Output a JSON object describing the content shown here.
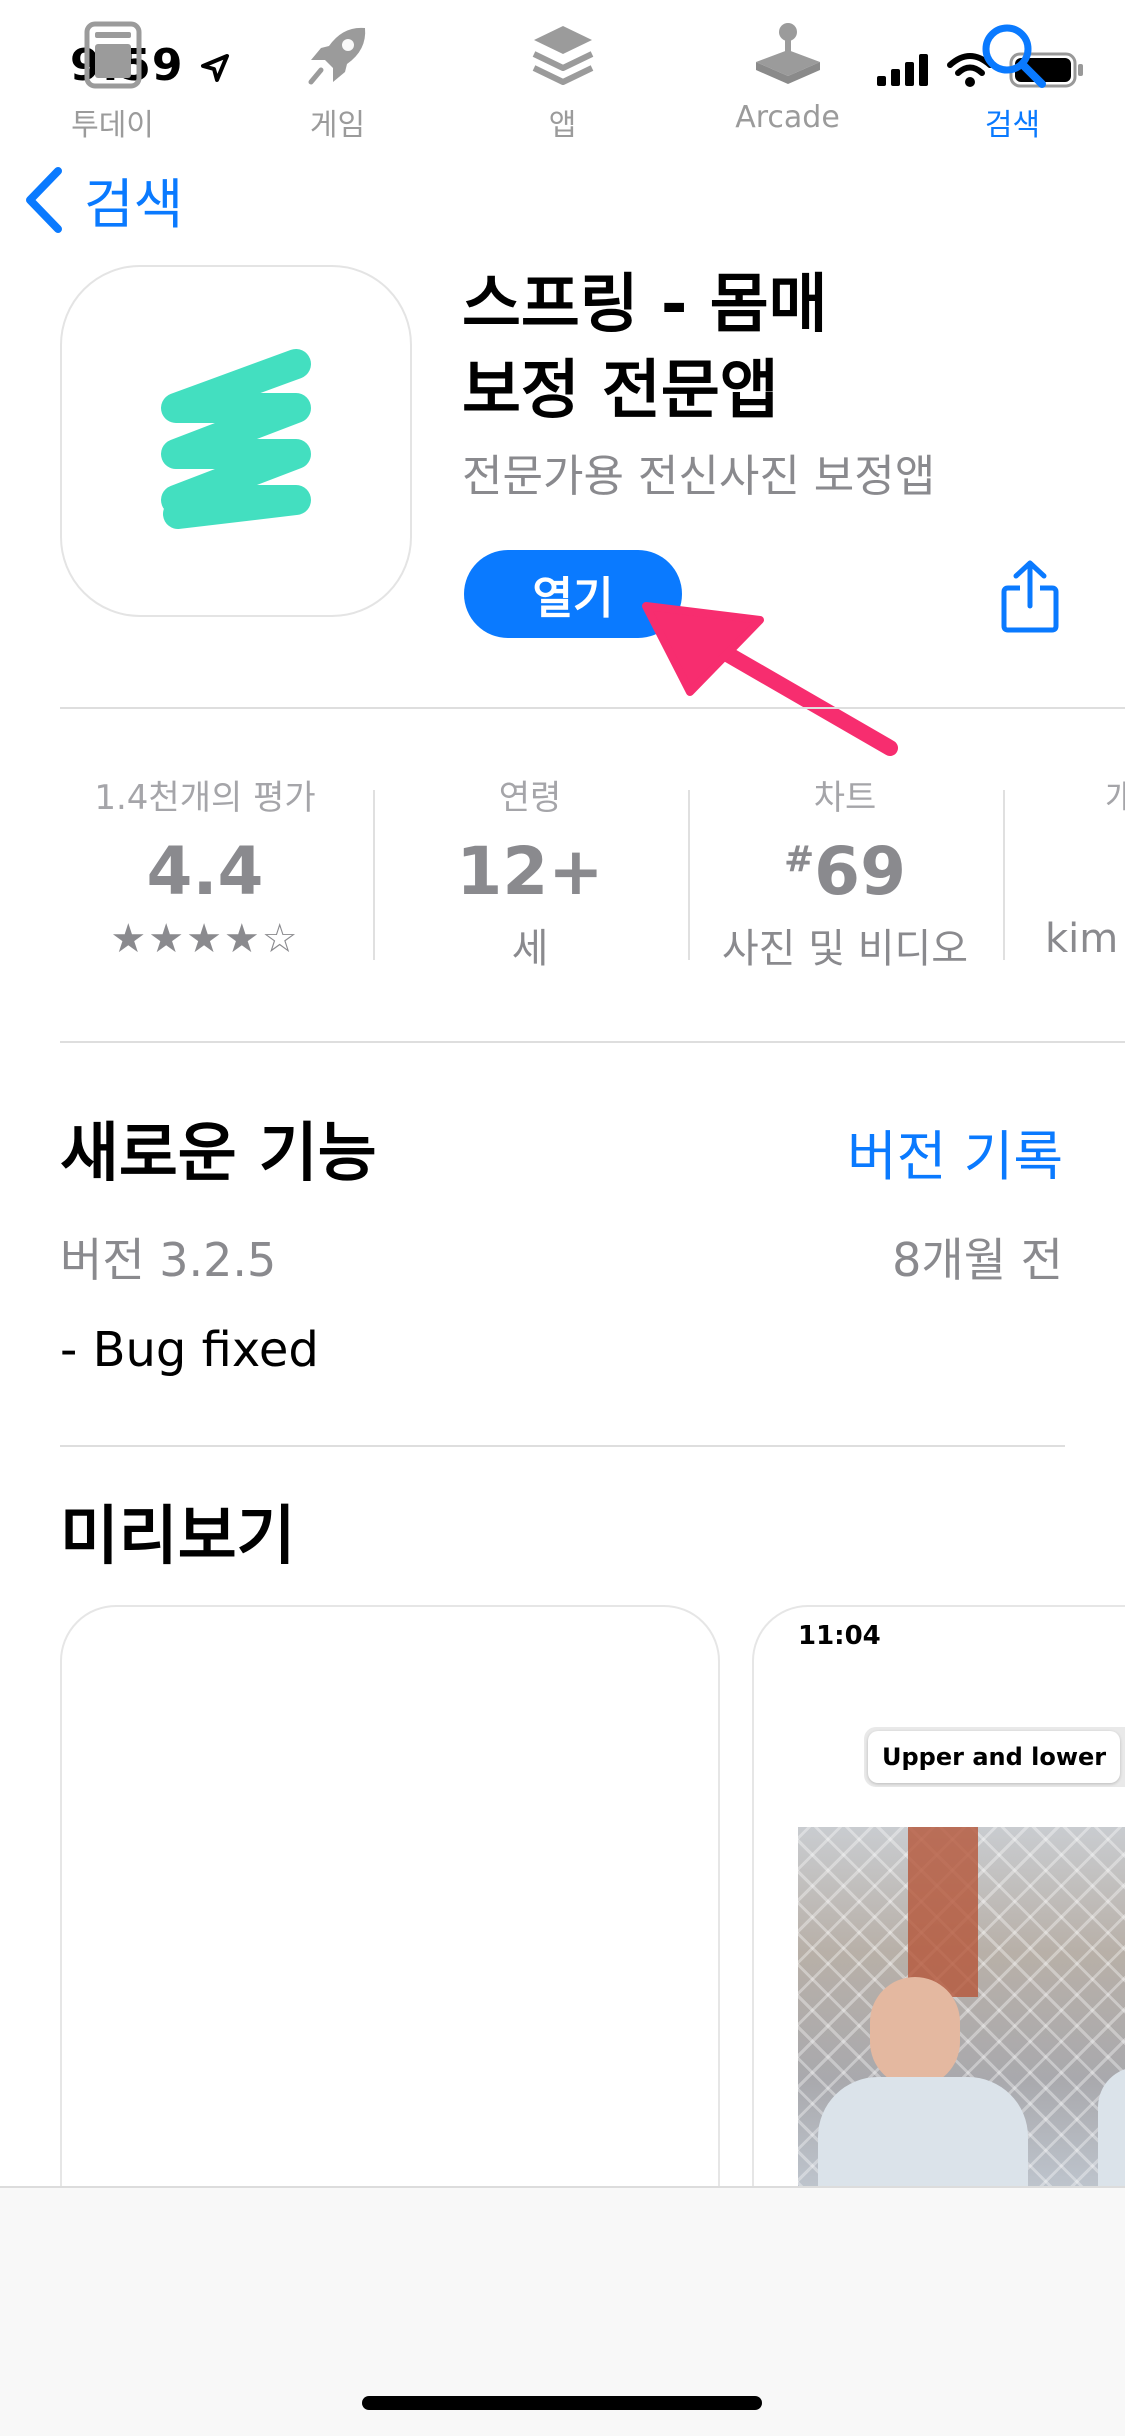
{
  "status": {
    "time": "9:59"
  },
  "nav": {
    "back_label": "검색"
  },
  "app": {
    "title_line1": "스프링 - 몸매",
    "title_line2": "보정 전문앱",
    "subtitle": "전문가용 전신사진 보정앱",
    "open_label": "열기",
    "brand_color": "#2fdcb9"
  },
  "info": [
    {
      "label": "1.4천개의 평가",
      "value": "4.4",
      "stars": "★★★★☆",
      "rating": 4.4
    },
    {
      "label": "연령",
      "value": "12+",
      "sub": "세"
    },
    {
      "label": "차트",
      "value_prefix": "#",
      "value": "69",
      "sub": "사진 및 비디오"
    },
    {
      "label": "개",
      "sub": "kim"
    }
  ],
  "whats_new": {
    "title": "새로운 기능",
    "history_link": "버전 기록",
    "version": "버전 3.2.5",
    "date": "8개월 전",
    "notes": "- Bug fixed"
  },
  "preview": {
    "title": "미리보기",
    "shot2_time": "11:04",
    "shot2_chip": "Upper and lower"
  },
  "tabs": [
    {
      "label": "투데이",
      "icon": "today-icon"
    },
    {
      "label": "게임",
      "icon": "rocket-icon"
    },
    {
      "label": "앱",
      "icon": "apps-stack-icon"
    },
    {
      "label": "Arcade",
      "icon": "arcade-joystick-icon"
    },
    {
      "label": "검색",
      "icon": "search-icon",
      "active": true
    }
  ],
  "colors": {
    "accent": "#0a7aff",
    "annotation_arrow": "#f72d6f"
  }
}
